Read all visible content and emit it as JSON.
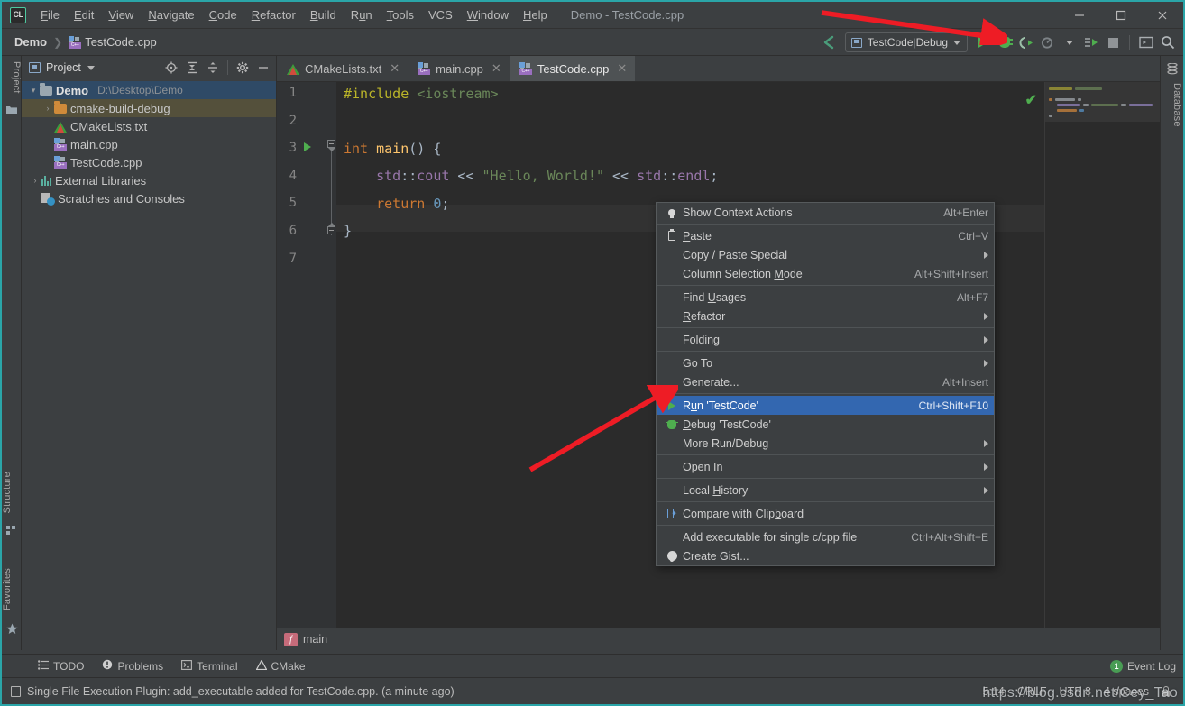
{
  "window": {
    "title": "Demo - TestCode.cpp",
    "logo_text": "CL",
    "controls": {
      "minimize": "—",
      "maximize": "▢",
      "close": "✕"
    }
  },
  "menubar": {
    "items": [
      {
        "label": "File",
        "mnemonic": "F"
      },
      {
        "label": "Edit",
        "mnemonic": "E"
      },
      {
        "label": "View",
        "mnemonic": "V"
      },
      {
        "label": "Navigate",
        "mnemonic": "N"
      },
      {
        "label": "Code",
        "mnemonic": "C"
      },
      {
        "label": "Refactor",
        "mnemonic": "R"
      },
      {
        "label": "Build",
        "mnemonic": "B"
      },
      {
        "label": "Run",
        "mnemonic": "u"
      },
      {
        "label": "Tools",
        "mnemonic": "T"
      },
      {
        "label": "VCS",
        "mnemonic": ""
      },
      {
        "label": "Window",
        "mnemonic": "W"
      },
      {
        "label": "Help",
        "mnemonic": "H"
      }
    ]
  },
  "breadcrumb": {
    "project": "Demo",
    "separator": "❯",
    "file": "TestCode.cpp",
    "file_icon": "cpp-file-icon"
  },
  "run_toolbar": {
    "back_icon": "back-arrow-icon",
    "config": {
      "name": "TestCode",
      "separator": "|",
      "mode": "Debug",
      "icon": "run-config-icon"
    },
    "buttons": [
      {
        "name": "run-button",
        "icon": "play-icon"
      },
      {
        "name": "debug-button",
        "icon": "bug-icon"
      },
      {
        "name": "run-with-coverage-button",
        "icon": "coverage-icon"
      },
      {
        "name": "profile-button",
        "icon": "profiler-icon"
      },
      {
        "name": "attach-to-process-button",
        "icon": "attach-icon"
      },
      {
        "name": "stop-button",
        "icon": "stop-icon"
      },
      {
        "name": "terminal-button",
        "icon": "terminal-icon"
      },
      {
        "name": "search-everywhere-button",
        "icon": "search-icon"
      }
    ]
  },
  "left_strip": {
    "project_tab": "Project",
    "structure_tab": "Structure",
    "favorites_tab": "Favorites"
  },
  "right_strip": {
    "database_tab": "Database"
  },
  "project_panel": {
    "title": "Project",
    "header_icons": [
      "locate-icon",
      "expand-all-icon",
      "collapse-all-icon",
      "gear-icon",
      "hide-icon"
    ],
    "tree": [
      {
        "indent": 0,
        "twisty": "▾",
        "icon": "folder-icon",
        "label": "Demo",
        "path": "D:\\Desktop\\Demo",
        "state": "selected-blue"
      },
      {
        "indent": 1,
        "twisty": "›",
        "icon": "folder-orange-icon",
        "label": "cmake-build-debug",
        "path": "",
        "state": "selected-amber"
      },
      {
        "indent": 2,
        "twisty": "",
        "icon": "cmake-file-icon",
        "label": "CMakeLists.txt",
        "path": "",
        "state": ""
      },
      {
        "indent": 2,
        "twisty": "",
        "icon": "cpp-file-icon",
        "label": "main.cpp",
        "path": "",
        "state": ""
      },
      {
        "indent": 2,
        "twisty": "",
        "icon": "cpp-file-icon",
        "label": "TestCode.cpp",
        "path": "",
        "state": ""
      },
      {
        "indent": 0,
        "twisty": "›",
        "icon": "libraries-icon",
        "label": "External Libraries",
        "path": "",
        "state": ""
      },
      {
        "indent": 1,
        "twisty": "",
        "icon": "scratches-icon",
        "label": "Scratches and Consoles",
        "path": "",
        "state": ""
      }
    ]
  },
  "editor": {
    "tabs": [
      {
        "label": "CMakeLists.txt",
        "icon": "cmake-file-icon",
        "active": false
      },
      {
        "label": "main.cpp",
        "icon": "cpp-file-icon",
        "active": false
      },
      {
        "label": "TestCode.cpp",
        "icon": "cpp-file-icon",
        "active": true
      }
    ],
    "line_numbers": [
      "1",
      "2",
      "3",
      "4",
      "5",
      "6",
      "7"
    ],
    "code_lines": [
      "#include <iostream>",
      "",
      "int main() {",
      "    std::cout << \"Hello, World!\" << std::endl;",
      "    return 0;",
      "}",
      ""
    ],
    "inspection_status": "✔",
    "breadcrumb_function": "main",
    "gutter_run_line": 3
  },
  "context_menu": {
    "items": [
      {
        "label": "Show Context Actions",
        "mnemonic": "",
        "shortcut": "Alt+Enter",
        "icon": "lightbulb-icon",
        "submenu": false,
        "selected": false,
        "sep_after": true
      },
      {
        "label": "Paste",
        "mnemonic": "P",
        "shortcut": "Ctrl+V",
        "icon": "clipboard-icon",
        "submenu": false,
        "selected": false,
        "sep_after": false
      },
      {
        "label": "Copy / Paste Special",
        "mnemonic": "",
        "shortcut": "",
        "icon": "",
        "submenu": true,
        "selected": false,
        "sep_after": false
      },
      {
        "label": "Column Selection Mode",
        "mnemonic": "M",
        "shortcut": "Alt+Shift+Insert",
        "icon": "",
        "submenu": false,
        "selected": false,
        "sep_after": true
      },
      {
        "label": "Find Usages",
        "mnemonic": "U",
        "shortcut": "Alt+F7",
        "icon": "",
        "submenu": false,
        "selected": false,
        "sep_after": false
      },
      {
        "label": "Refactor",
        "mnemonic": "R",
        "shortcut": "",
        "icon": "",
        "submenu": true,
        "selected": false,
        "sep_after": true
      },
      {
        "label": "Folding",
        "mnemonic": "",
        "shortcut": "",
        "icon": "",
        "submenu": true,
        "selected": false,
        "sep_after": true
      },
      {
        "label": "Go To",
        "mnemonic": "",
        "shortcut": "",
        "icon": "",
        "submenu": true,
        "selected": false,
        "sep_after": false
      },
      {
        "label": "Generate...",
        "mnemonic": "",
        "shortcut": "Alt+Insert",
        "icon": "",
        "submenu": false,
        "selected": false,
        "sep_after": true
      },
      {
        "label": "Run 'TestCode'",
        "mnemonic": "n",
        "shortcut": "Ctrl+Shift+F10",
        "icon": "play-icon",
        "submenu": false,
        "selected": true,
        "sep_after": false
      },
      {
        "label": "Debug 'TestCode'",
        "mnemonic": "D",
        "shortcut": "",
        "icon": "bug-icon",
        "submenu": false,
        "selected": false,
        "sep_after": false
      },
      {
        "label": "More Run/Debug",
        "mnemonic": "",
        "shortcut": "",
        "icon": "",
        "submenu": true,
        "selected": false,
        "sep_after": true
      },
      {
        "label": "Open In",
        "mnemonic": "",
        "shortcut": "",
        "icon": "",
        "submenu": true,
        "selected": false,
        "sep_after": true
      },
      {
        "label": "Local History",
        "mnemonic": "H",
        "shortcut": "",
        "icon": "",
        "submenu": true,
        "selected": false,
        "sep_after": true
      },
      {
        "label": "Compare with Clipboard",
        "mnemonic": "b",
        "shortcut": "",
        "icon": "compare-clipboard-icon",
        "submenu": false,
        "selected": false,
        "sep_after": true
      },
      {
        "label": "Add executable for single c/cpp file",
        "mnemonic": "",
        "shortcut": "Ctrl+Alt+Shift+E",
        "icon": "",
        "submenu": false,
        "selected": false,
        "sep_after": false
      },
      {
        "label": "Create Gist...",
        "mnemonic": "",
        "shortcut": "",
        "icon": "github-icon",
        "submenu": false,
        "selected": false,
        "sep_after": false
      }
    ]
  },
  "bottom_bar": {
    "items": [
      {
        "label": "TODO",
        "icon": "todo-icon"
      },
      {
        "label": "Problems",
        "icon": "problems-icon"
      },
      {
        "label": "Terminal",
        "icon": "terminal-icon"
      },
      {
        "label": "CMake",
        "icon": "cmake-icon"
      }
    ],
    "event_log": {
      "label": "Event Log",
      "count": "1"
    }
  },
  "status_bar": {
    "message": "Single File Execution Plugin: add_executable added for TestCode.cpp. (a minute ago)",
    "caret_position": "5:14",
    "line_separator": "CRLF",
    "encoding": "UTF-8",
    "indent": "4 spaces",
    "lock_icon": "read-write-lock-icon"
  },
  "watermark": {
    "text": "https://blog.csdn.net/Cey_Tao"
  },
  "colors": {
    "accent_border": "#2aa5a8",
    "panel_bg": "#3c3f41",
    "editor_bg": "#2b2b2b",
    "gutter_bg": "#313335",
    "selection_blue": "#3367b0",
    "tree_selected_blue": "#2f4a66",
    "tree_selected_amber": "#54503b",
    "run_green": "#4fae4f",
    "annotation_red": "#ee1c25"
  }
}
